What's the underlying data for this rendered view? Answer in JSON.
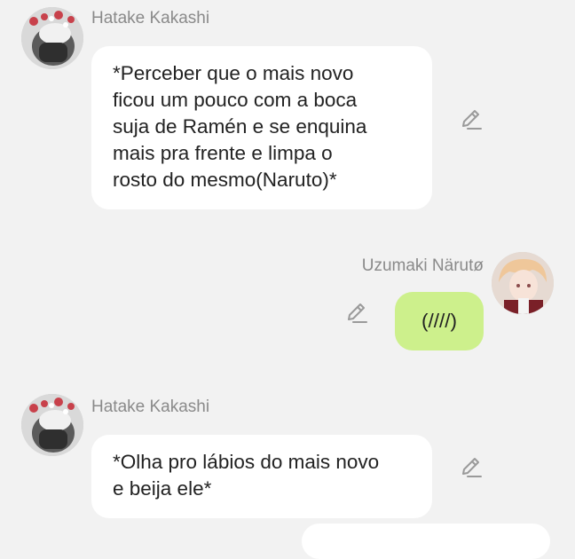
{
  "messages": [
    {
      "sender": "Hatake Kakashi",
      "text": "*Perceber que o mais novo\nficou um pouco com a boca\nsuja de Ramén e se enquina\nmais pra frente e limpa o\nrosto do mesmo(Naruto)*",
      "side": "left",
      "avatar_icon": "avatar-dark-hair-flowers"
    },
    {
      "sender": "Uzumaki Närutø",
      "text": "(////)",
      "side": "right",
      "avatar_icon": "avatar-blond-hair"
    },
    {
      "sender": "Hatake Kakashi",
      "text": "*Olha pro lábios do mais novo\ne beija ele*",
      "side": "left",
      "avatar_icon": "avatar-dark-hair-flowers"
    }
  ],
  "colors": {
    "background": "#f2f2f2",
    "bubble_incoming": "#ffffff",
    "bubble_outgoing": "#cdf08c",
    "sender_name": "#8a8a8a",
    "edit_icon": "#9a9a9a"
  },
  "icons": {
    "edit": "pencil-edit-icon"
  }
}
